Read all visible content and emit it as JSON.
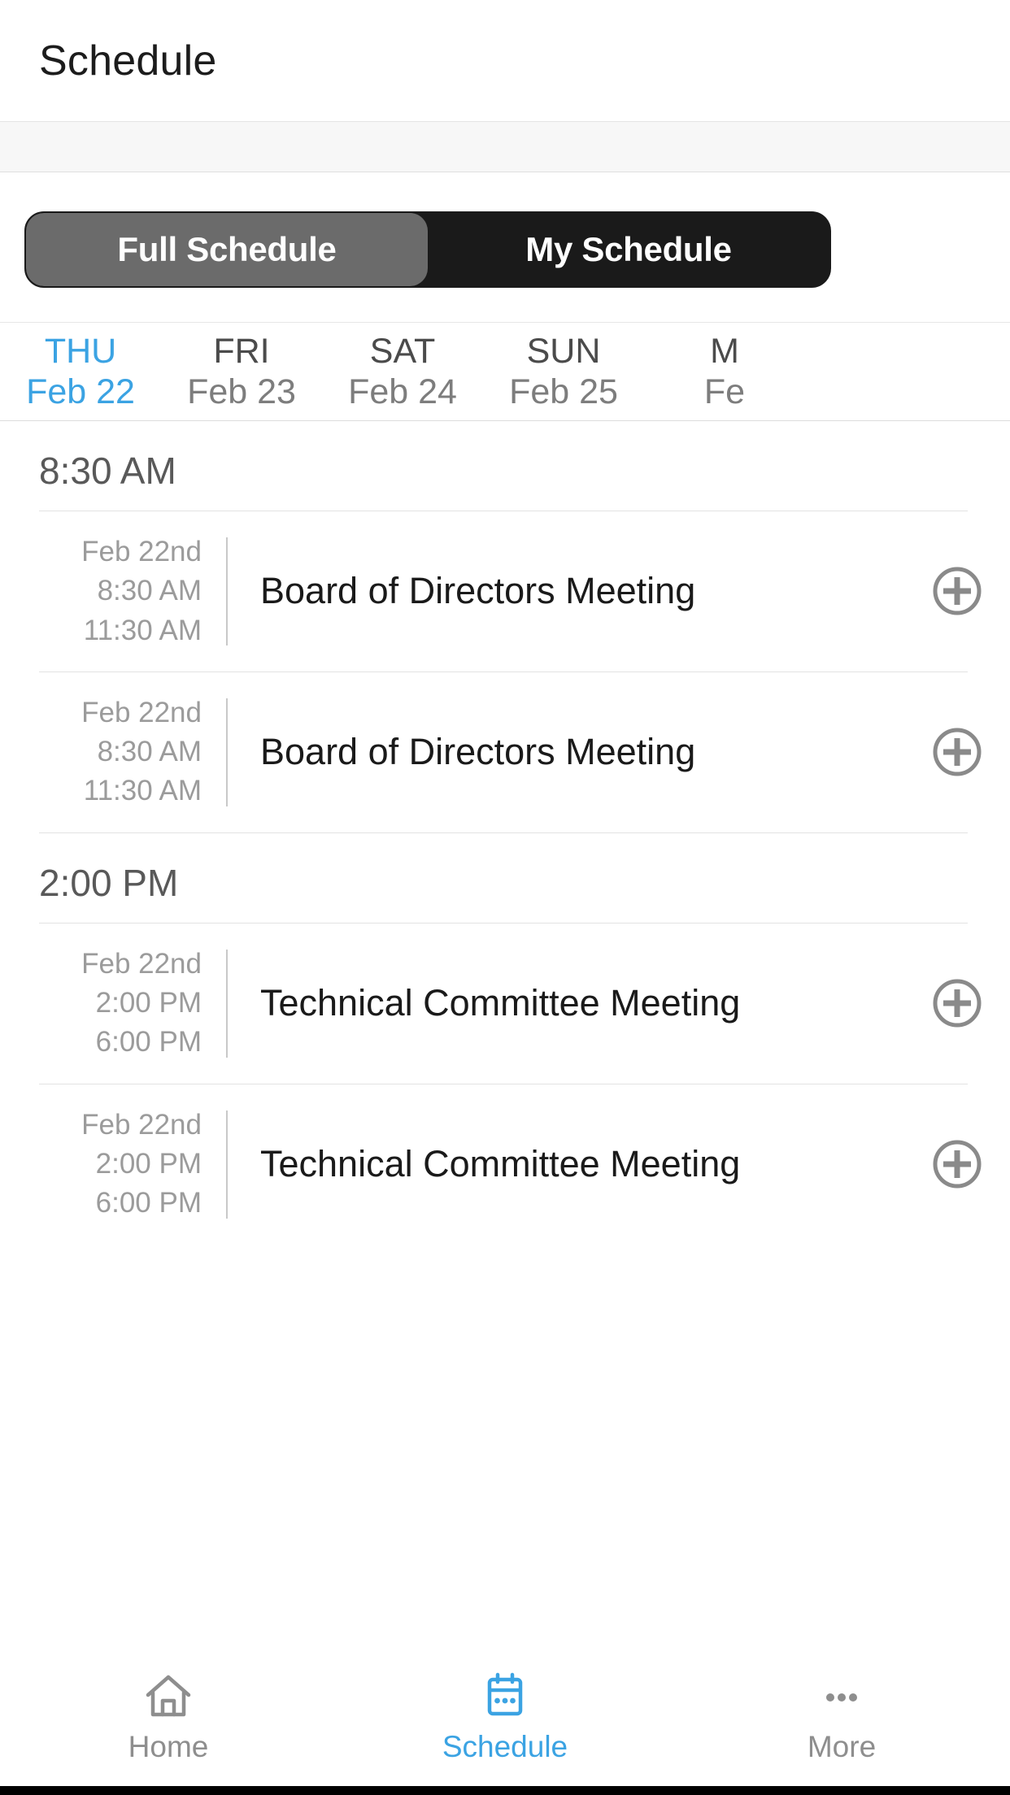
{
  "header": {
    "title": "Schedule"
  },
  "segmented_control": {
    "options": [
      {
        "label": "Full Schedule",
        "selected": true
      },
      {
        "label": "My Schedule",
        "selected": false
      }
    ]
  },
  "date_tabs": [
    {
      "dow": "THU",
      "date": "Feb 22",
      "active": true
    },
    {
      "dow": "FRI",
      "date": "Feb 23",
      "active": false
    },
    {
      "dow": "SAT",
      "date": "Feb 24",
      "active": false
    },
    {
      "dow": "SUN",
      "date": "Feb 25",
      "active": false
    },
    {
      "dow": "M",
      "date": "Fe",
      "active": false
    }
  ],
  "sections": [
    {
      "time_label": "8:30 AM",
      "events": [
        {
          "date": "Feb 22nd",
          "start": "8:30 AM",
          "end": "11:30 AM",
          "title": "Board of Directors Meeting",
          "add_icon": "plus-circle-icon"
        },
        {
          "date": "Feb 22nd",
          "start": "8:30 AM",
          "end": "11:30 AM",
          "title": "Board of Directors Meeting",
          "add_icon": "plus-circle-icon"
        }
      ]
    },
    {
      "time_label": "2:00 PM",
      "events": [
        {
          "date": "Feb 22nd",
          "start": "2:00 PM",
          "end": "6:00 PM",
          "title": "Technical Committee Meeting",
          "add_icon": "plus-circle-icon"
        },
        {
          "date": "Feb 22nd",
          "start": "2:00 PM",
          "end": "6:00 PM",
          "title": "Technical Committee Meeting",
          "add_icon": "plus-circle-icon"
        }
      ]
    }
  ],
  "tab_bar": [
    {
      "label": "Home",
      "icon": "home-icon",
      "active": false
    },
    {
      "label": "Schedule",
      "icon": "calendar-icon",
      "active": true
    },
    {
      "label": "More",
      "icon": "ellipsis-icon",
      "active": false
    }
  ],
  "colors": {
    "accent_blue": "#3ba3e3",
    "segment_selected": "#6b6b6b",
    "segment_track": "#1a1a1a",
    "muted_text": "#9b9b9b",
    "divider": "#e3e3e3"
  }
}
